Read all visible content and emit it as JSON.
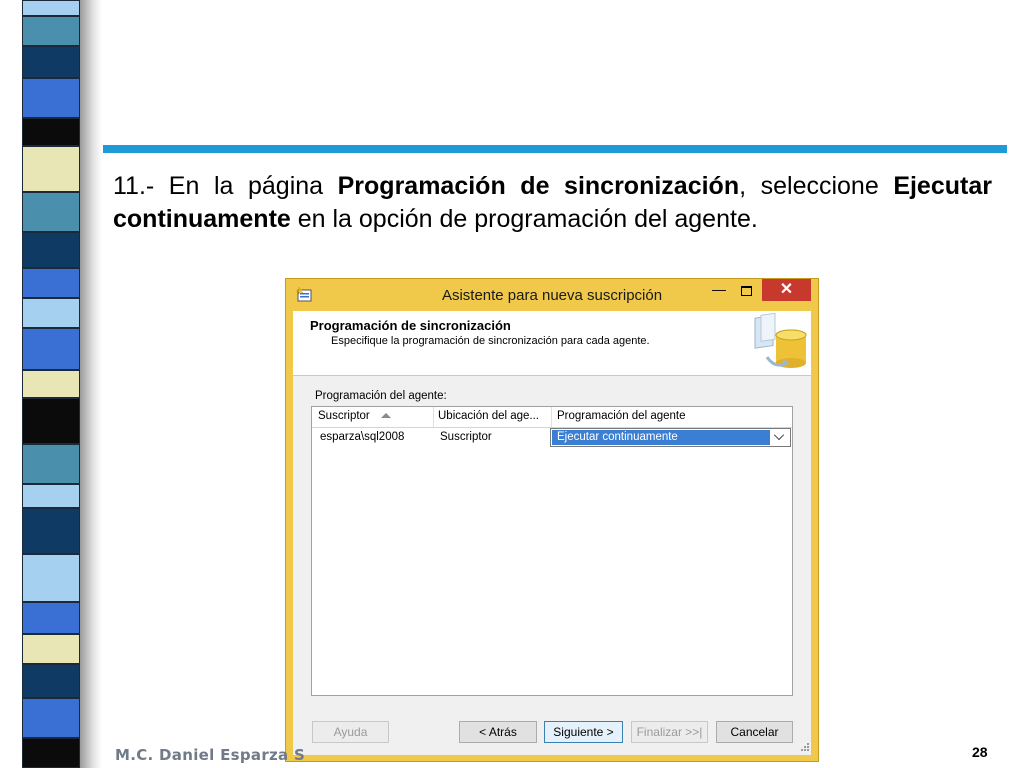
{
  "slide": {
    "instruction_prefix": "11.- En la página ",
    "instruction_bold1": "Programación de sincronización",
    "instruction_mid": ", seleccione ",
    "instruction_bold2": "Ejecutar continuamente",
    "instruction_suffix": " en la opción de programación del agente.",
    "footer_author": "M.C. Daniel Esparza S",
    "page_number": "28",
    "colors": {
      "accent_line": "#1e9bd7",
      "stripe_dark": "#0e3a63",
      "stripe_blue": "#3a6fd3",
      "stripe_cream": "#e8e6b4",
      "stripe_light": "#a6d0ef",
      "stripe_teal": "#4a90ad"
    }
  },
  "dialog": {
    "title": "Asistente para nueva suscripción",
    "minimize_glyph": "—",
    "close_glyph": "✕",
    "header_title": "Programación de sincronización",
    "header_subtitle": "Especifique la programación de sincronización para cada agente.",
    "agent_label": "Programación del agente:",
    "columns": [
      "Suscriptor",
      "Ubicación del age...",
      "Programación del agente"
    ],
    "rows": [
      {
        "subscriber": "esparza\\sql2008",
        "location": "Suscriptor",
        "schedule": "Ejecutar continuamente"
      }
    ],
    "buttons": {
      "help": "Ayuda",
      "back": "< Atrás",
      "next": "Siguiente >",
      "finish": "Finalizar >>|",
      "cancel": "Cancelar"
    }
  }
}
